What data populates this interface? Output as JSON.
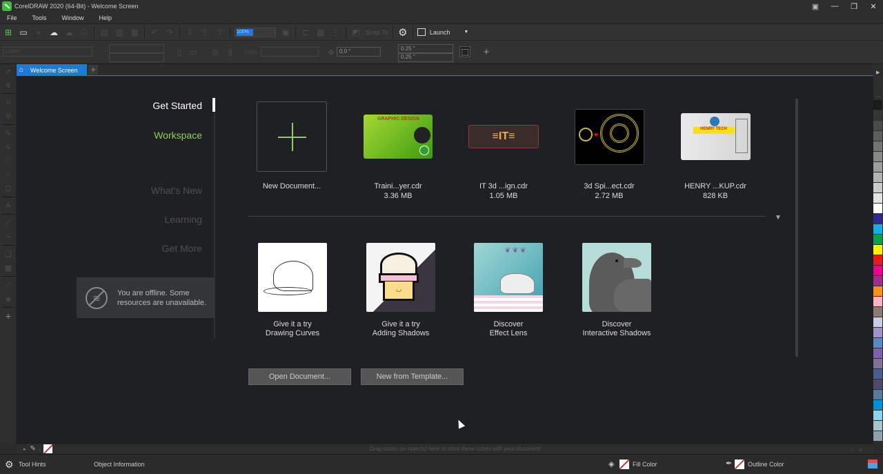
{
  "window": {
    "title": "CorelDRAW 2020 (64-Bit) - Welcome Screen",
    "controls": [
      "minimize",
      "restore",
      "close"
    ]
  },
  "menu": [
    "File",
    "Tools",
    "Window",
    "Help"
  ],
  "toolbar": {
    "zoom_value": "100%",
    "snap_to": "Snap To",
    "launch": "Launch"
  },
  "property_bar": {
    "page_size": "Letter",
    "units_label": "Units:",
    "nudge": "0.0 \"",
    "dup_x": "0.25 \"",
    "dup_y": "0.25 \""
  },
  "tab": {
    "label": "Welcome Screen"
  },
  "nav": {
    "items": [
      {
        "label": "Get Started",
        "state": "active"
      },
      {
        "label": "Workspace",
        "state": "highlight"
      },
      {
        "label": "What's New",
        "state": "disabled"
      },
      {
        "label": "Learning",
        "state": "disabled"
      },
      {
        "label": "Get More",
        "state": "disabled"
      }
    ]
  },
  "offline_notice": "You are offline. Some resources are unavailable.",
  "recent": {
    "new_document": "New Document...",
    "files": [
      {
        "name": "Traini...yer.cdr",
        "size": "3.36 MB",
        "thumb": "graphic-design-flyer"
      },
      {
        "name": "IT 3d ...ign.cdr",
        "size": "1.05 MB",
        "thumb": "it-logo"
      },
      {
        "name": "3d Spi...ect.cdr",
        "size": "2.72 MB",
        "thumb": "spiral-effect"
      },
      {
        "name": "HENRY ...KUP.cdr",
        "size": "828 KB",
        "thumb": "henry-tech-mockup"
      }
    ]
  },
  "tutorials": [
    {
      "line1": "Give it a try",
      "line2": "Drawing Curves",
      "thumb": "cap"
    },
    {
      "line1": "Give it a try",
      "line2": "Adding Shadows",
      "thumb": "cupcake"
    },
    {
      "line1": "Discover",
      "line2": "Effect Lens",
      "thumb": "cat"
    },
    {
      "line1": "Discover",
      "line2": "Interactive Shadows",
      "thumb": "crow"
    }
  ],
  "buttons": {
    "open": "Open Document...",
    "template": "New from Template..."
  },
  "palette_hint": "Drag colors (or objects) here to store these colors with your document",
  "status": {
    "tool_hints": "Tool Hints",
    "object_info": "Object Information",
    "fill": "Fill Color",
    "outline": "Outline Color"
  },
  "palette_colors": [
    "#1c1c1c",
    "#353535",
    "#4a4a4a",
    "#5e5e5e",
    "#737373",
    "#888888",
    "#9d9d9d",
    "#b3b3b3",
    "#cbcbcb",
    "#e3e3e3",
    "#ffffff",
    "#2b2a8f",
    "#12aee8",
    "#0aa14a",
    "#fff200",
    "#e31b23",
    "#ec008c",
    "#9b2f8f",
    "#f7901e",
    "#f9b3c4",
    "#8c7b75",
    "#cdcbe4",
    "#9f92c7",
    "#5b89c5",
    "#7c64ad",
    "#807297",
    "#4a5f8f",
    "#4d4a6e",
    "#5a7997",
    "#0091d5",
    "#8dd3f0",
    "#a9c4cb",
    "#8ea2aa"
  ]
}
